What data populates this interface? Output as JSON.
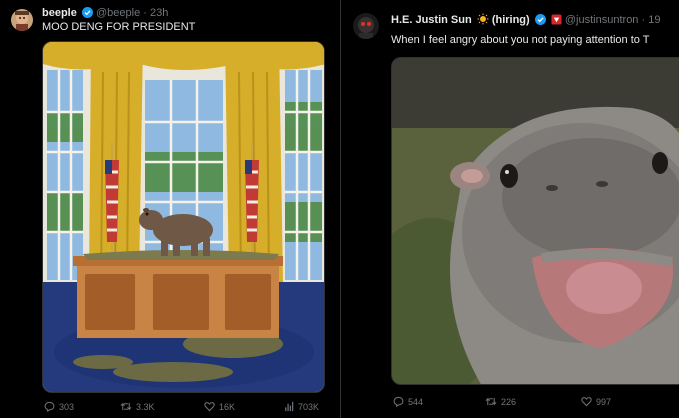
{
  "colors": {
    "background": "#000000",
    "text_primary": "#e7e9ea",
    "text_secondary": "#71767b",
    "verified_blue": "#1d9bf0",
    "divider": "#2f3336"
  },
  "tweets": [
    {
      "author_name": "beeple",
      "verified_icon": "verified-badge-icon",
      "handle": "@beeple",
      "separator": "·",
      "time": "23h",
      "text": "MOO DENG FOR PRESIDENT",
      "media_description_icon": "hippo-oval-office-image",
      "actions": {
        "replies": "303",
        "retweets": "3.3K",
        "likes": "16K",
        "views": "703K"
      }
    },
    {
      "author_name": "H.E. Justin Sun",
      "name_suffix": "(hiring)",
      "verified_icon": "verified-badge-icon",
      "handle": "@justinsuntron",
      "separator": "·",
      "time": "19",
      "text": "When I feel angry about you not paying attention to T",
      "media_description_icon": "baby-hippo-photo",
      "actions": {
        "replies": "544",
        "retweets": "226",
        "likes": "997"
      }
    }
  ]
}
